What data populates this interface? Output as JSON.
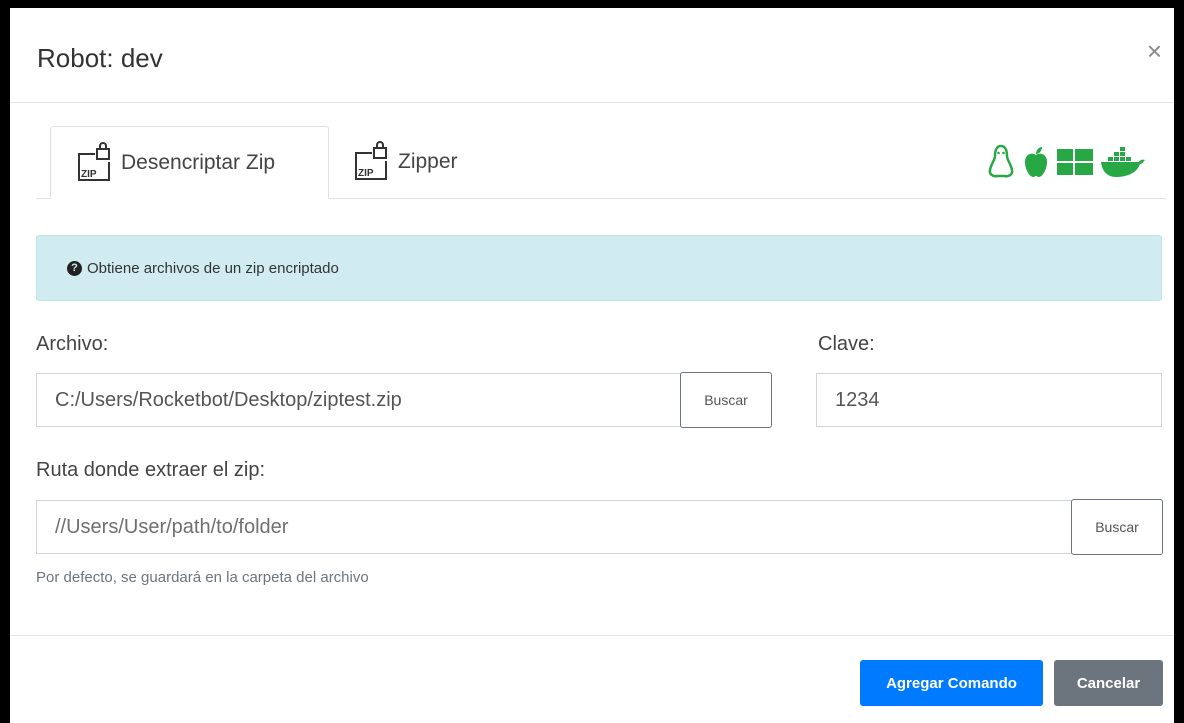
{
  "modal": {
    "title": "Robot: dev",
    "close_symbol": "×"
  },
  "tabs": [
    {
      "label": "Desencriptar Zip",
      "icon": "zip-lock-icon",
      "active": true
    },
    {
      "label": "Zipper",
      "icon": "zip-lock-icon",
      "active": false
    }
  ],
  "os_icons": [
    "linux-icon",
    "apple-icon",
    "windows-icon",
    "docker-icon"
  ],
  "os_icon_color": "#28a745",
  "alert": {
    "text": "Obtiene archivos de un zip encriptado",
    "icon": "question-circle-icon"
  },
  "form": {
    "archivo_label": "Archivo:",
    "archivo_value": "C:/Users/Rocketbot/Desktop/ziptest.zip",
    "archivo_button": "Buscar",
    "clave_label": "Clave:",
    "clave_value": "1234",
    "ruta_label": "Ruta donde extraer el zip:",
    "ruta_placeholder": "//Users/User/path/to/folder",
    "ruta_button": "Buscar",
    "ruta_help": "Por defecto, se guardará en la carpeta del archivo"
  },
  "footer": {
    "primary_label": "Agregar Comando",
    "secondary_label": "Cancelar"
  },
  "colors": {
    "primary": "#007bff",
    "secondary": "#6c757d",
    "alert_bg": "#d1ecf1"
  }
}
